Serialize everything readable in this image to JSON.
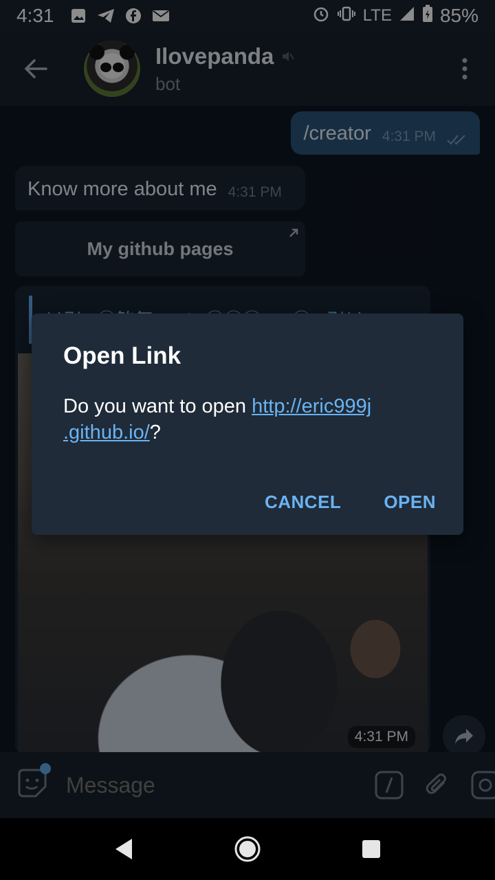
{
  "status_bar": {
    "time": "4:31",
    "network": "LTE",
    "battery": "85%"
  },
  "header": {
    "title": "Ilovepanda",
    "subtitle": "bot"
  },
  "messages": {
    "outgoing": {
      "text": "/creator",
      "time": "4:31 PM"
    },
    "incoming": {
      "text": "Know more about me",
      "time": "4:31 PM"
    },
    "inline_button": {
      "label": "My github pages"
    },
    "forwarded": {
      "name": "乂卍↘㊣煞氣a Eric ⓋⒾⓅ Lu ㊣↖卍乂",
      "time": "4:31 PM"
    }
  },
  "composer": {
    "placeholder": "Message"
  },
  "dialog": {
    "title": "Open Link",
    "body_prefix": "Do you want to open ",
    "link_line1": "http://eric999j",
    "link_line2": ".github.io/",
    "body_suffix": "?",
    "cancel_label": "CANCEL",
    "open_label": "OPEN"
  },
  "colors": {
    "accent": "#6ab3f3",
    "outgoing_bubble": "#2b5278",
    "incoming_bubble": "#182533",
    "background": "#0e1621"
  }
}
